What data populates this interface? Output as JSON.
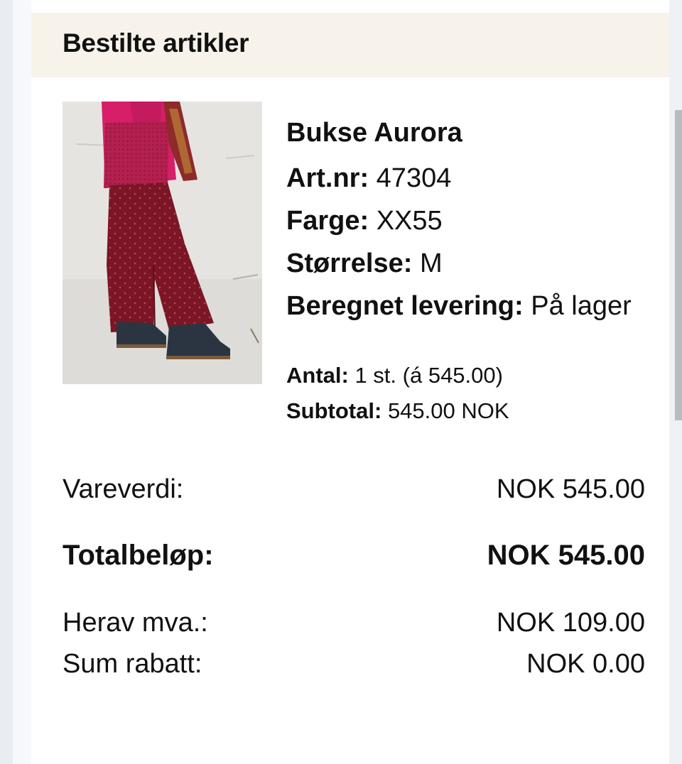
{
  "order": {
    "section_title": "Bestilte artikler"
  },
  "item": {
    "name": "Bukse Aurora",
    "attributes": [
      {
        "label": "Art.nr:",
        "value": "47304"
      },
      {
        "label": "Farge:",
        "value": "XX55"
      },
      {
        "label": "Størrelse:",
        "value": "M"
      },
      {
        "label": "Beregnet levering:",
        "value": "På lager"
      }
    ],
    "quantity_label": "Antal:",
    "quantity_value": "1 st. (á 545.00)",
    "subtotal_label": "Subtotal:",
    "subtotal_value": "545.00 NOK"
  },
  "summary": {
    "goods_value_label": "Vareverdi:",
    "goods_value": "NOK 545.00",
    "total_label": "Totalbeløp:",
    "total_value": "NOK 545.00",
    "vat_label": "Herav mva.:",
    "vat_value": "NOK 109.00",
    "discount_label": "Sum rabatt:",
    "discount_value": "NOK 0.00"
  },
  "colors": {
    "header_background": "#f7f3ea",
    "card_background": "#ffffff",
    "page_background": "#eef1f5"
  }
}
